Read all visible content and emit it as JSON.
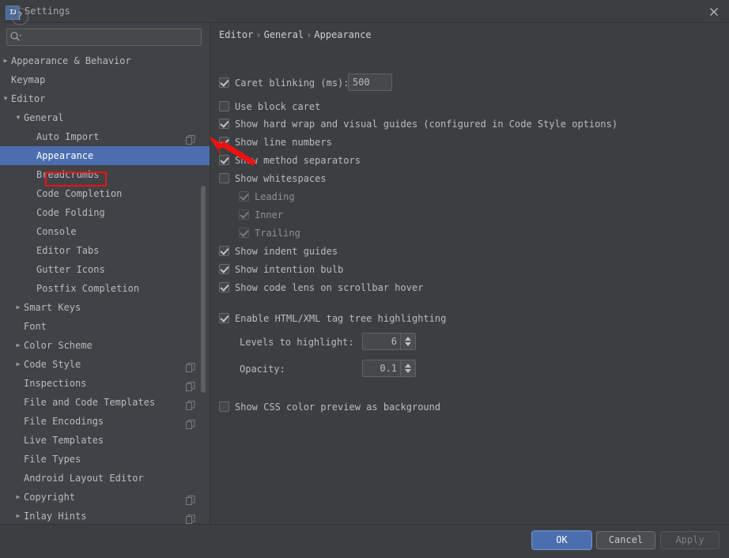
{
  "window": {
    "title": "Settings",
    "app_icon_label": "IJ",
    "close_icon": "close-icon"
  },
  "sidebar": {
    "search": {
      "placeholder": "",
      "value": "",
      "icon": "search-icon"
    },
    "tree_items": [
      {
        "label": "Appearance & Behavior",
        "depth": 0,
        "arrow": "▶",
        "selected": false,
        "copy_icon": false
      },
      {
        "label": "Keymap",
        "depth": 0,
        "arrow": "",
        "selected": false,
        "copy_icon": false
      },
      {
        "label": "Editor",
        "depth": 0,
        "arrow": "▼",
        "selected": false,
        "copy_icon": false
      },
      {
        "label": "General",
        "depth": 1,
        "arrow": "▼",
        "selected": false,
        "copy_icon": false
      },
      {
        "label": "Auto Import",
        "depth": 2,
        "arrow": "",
        "selected": false,
        "copy_icon": true
      },
      {
        "label": "Appearance",
        "depth": 2,
        "arrow": "",
        "selected": true,
        "copy_icon": false
      },
      {
        "label": "Breadcrumbs",
        "depth": 2,
        "arrow": "",
        "selected": false,
        "copy_icon": false
      },
      {
        "label": "Code Completion",
        "depth": 2,
        "arrow": "",
        "selected": false,
        "copy_icon": false
      },
      {
        "label": "Code Folding",
        "depth": 2,
        "arrow": "",
        "selected": false,
        "copy_icon": false
      },
      {
        "label": "Console",
        "depth": 2,
        "arrow": "",
        "selected": false,
        "copy_icon": false
      },
      {
        "label": "Editor Tabs",
        "depth": 2,
        "arrow": "",
        "selected": false,
        "copy_icon": false
      },
      {
        "label": "Gutter Icons",
        "depth": 2,
        "arrow": "",
        "selected": false,
        "copy_icon": false
      },
      {
        "label": "Postfix Completion",
        "depth": 2,
        "arrow": "",
        "selected": false,
        "copy_icon": false
      },
      {
        "label": "Smart Keys",
        "depth": 1,
        "arrow": "▶",
        "selected": false,
        "copy_icon": false
      },
      {
        "label": "Font",
        "depth": 1,
        "arrow": "",
        "selected": false,
        "copy_icon": false
      },
      {
        "label": "Color Scheme",
        "depth": 1,
        "arrow": "▶",
        "selected": false,
        "copy_icon": false
      },
      {
        "label": "Code Style",
        "depth": 1,
        "arrow": "▶",
        "selected": false,
        "copy_icon": true
      },
      {
        "label": "Inspections",
        "depth": 1,
        "arrow": "",
        "selected": false,
        "copy_icon": true
      },
      {
        "label": "File and Code Templates",
        "depth": 1,
        "arrow": "",
        "selected": false,
        "copy_icon": true
      },
      {
        "label": "File Encodings",
        "depth": 1,
        "arrow": "",
        "selected": false,
        "copy_icon": true
      },
      {
        "label": "Live Templates",
        "depth": 1,
        "arrow": "",
        "selected": false,
        "copy_icon": false
      },
      {
        "label": "File Types",
        "depth": 1,
        "arrow": "",
        "selected": false,
        "copy_icon": false
      },
      {
        "label": "Android Layout Editor",
        "depth": 1,
        "arrow": "",
        "selected": false,
        "copy_icon": false
      },
      {
        "label": "Copyright",
        "depth": 1,
        "arrow": "▶",
        "selected": false,
        "copy_icon": true
      },
      {
        "label": "Inlay Hints",
        "depth": 1,
        "arrow": "▶",
        "selected": false,
        "copy_icon": true
      }
    ]
  },
  "main": {
    "breadcrumb": {
      "parts": [
        "Editor",
        "General",
        "Appearance"
      ],
      "separator": "›"
    },
    "options": [
      {
        "label": "Caret blinking (ms):",
        "checked": true,
        "disabled": false
      },
      {
        "label": "Use block caret",
        "checked": false,
        "disabled": false
      },
      {
        "label": "Show hard wrap and visual guides (configured in Code Style options)",
        "checked": true,
        "disabled": false
      },
      {
        "label": "Show line numbers",
        "checked": true,
        "disabled": false
      },
      {
        "label": "Show method separators",
        "checked": true,
        "disabled": false
      },
      {
        "label": "Show whitespaces",
        "checked": false,
        "disabled": false
      },
      {
        "label": "Leading",
        "checked": true,
        "disabled": true
      },
      {
        "label": "Inner",
        "checked": true,
        "disabled": true
      },
      {
        "label": "Trailing",
        "checked": true,
        "disabled": true
      },
      {
        "label": "Show indent guides",
        "checked": true,
        "disabled": false
      },
      {
        "label": "Show intention bulb",
        "checked": true,
        "disabled": false
      },
      {
        "label": "Show code lens on scrollbar hover",
        "checked": true,
        "disabled": false
      },
      {
        "label": "Enable HTML/XML tag tree highlighting",
        "checked": true,
        "disabled": false
      },
      {
        "label": "Show CSS color preview as background",
        "checked": false,
        "disabled": false
      }
    ],
    "caret_blinking_value": "500",
    "levels_to_highlight_label": "Levels to highlight:",
    "levels_to_highlight_value": "6",
    "opacity_label": "Opacity:",
    "opacity_value": "0.1"
  },
  "footer": {
    "help_label": "?",
    "ok_label": "OK",
    "cancel_label": "Cancel",
    "apply_label": "Apply"
  },
  "annotation": {
    "arrow_color": "#ee1111",
    "highlight_color": "#ee1111",
    "target": "Appearance"
  },
  "colors": {
    "selection": "#4b6eaf",
    "panel_bg": "#3c3f41",
    "sidebar_bg": "#3f4246",
    "text": "#bbbbbb"
  }
}
